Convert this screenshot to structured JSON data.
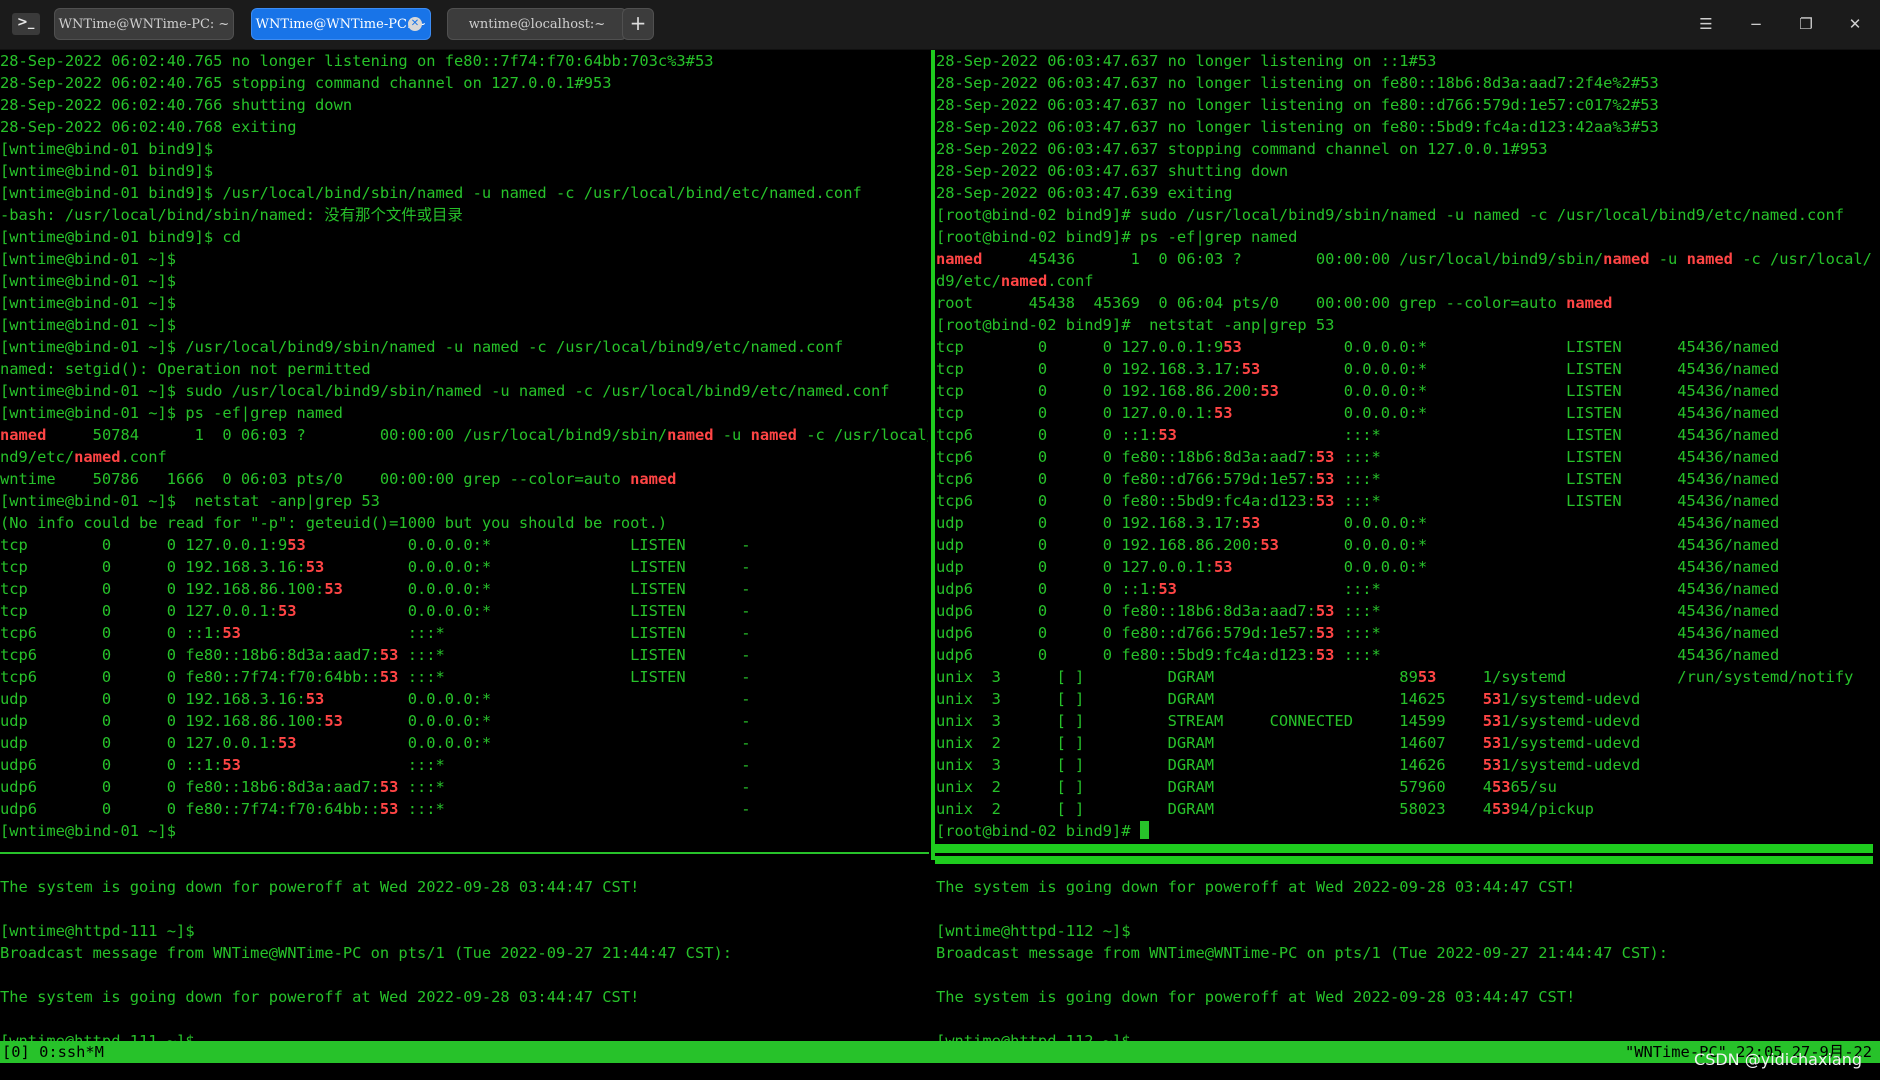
{
  "window": {
    "tabs": [
      {
        "label": "WNTime@WNTime-PC: ~",
        "active": false
      },
      {
        "label": "WNTime@WNTime-PC: ~",
        "active": true
      },
      {
        "label": "wntime@localhost:~",
        "active": false
      }
    ],
    "add_tab": "+",
    "controls": {
      "menu": "☰",
      "minimize": "−",
      "maximize": "❐",
      "close": "✕"
    }
  },
  "colors": {
    "terminal_green": "#27c22a",
    "highlight_red": "#ff4545",
    "active_tab": "#1874e8"
  },
  "panes": {
    "top_left": [
      [
        "28-Sep-2022 06:02:40.765 no longer listening on fe80::7f74:f70:64bb:703c%3#53"
      ],
      [
        "28-Sep-2022 06:02:40.765 stopping command channel on 127.0.0.1#953"
      ],
      [
        "28-Sep-2022 06:02:40.766 shutting down"
      ],
      [
        "28-Sep-2022 06:02:40.768 exiting"
      ],
      [
        "[wntime@bind-01 bind9]$"
      ],
      [
        "[wntime@bind-01 bind9]$"
      ],
      [
        "[wntime@bind-01 bind9]$ /usr/local/bind/sbin/named -u named -c /usr/local/bind/etc/named.conf"
      ],
      [
        "-bash: /usr/local/bind/sbin/named: 没有那个文件或目录"
      ],
      [
        "[wntime@bind-01 bind9]$ cd"
      ],
      [
        "[wntime@bind-01 ~]$"
      ],
      [
        "[wntime@bind-01 ~]$"
      ],
      [
        "[wntime@bind-01 ~]$"
      ],
      [
        "[wntime@bind-01 ~]$"
      ],
      [
        "[wntime@bind-01 ~]$ /usr/local/bind9/sbin/named -u named -c /usr/local/bind9/etc/named.conf"
      ],
      [
        "named: setgid(): Operation not permitted"
      ],
      [
        "[wntime@bind-01 ~]$ sudo /usr/local/bind9/sbin/named -u named -c /usr/local/bind9/etc/named.conf"
      ],
      [
        "[wntime@bind-01 ~]$ ps -ef|grep named"
      ],
      [
        {
          "h": "named"
        },
        "     50784      1  0 06:03 ?        00:00:00 /usr/local/bind9/sbin/",
        {
          "h": "named"
        },
        " -u ",
        {
          "h": "named"
        },
        " -c /usr/local/bi"
      ],
      [
        "nd9/etc/",
        {
          "h": "named"
        },
        ".conf"
      ],
      [
        "wntime    50786   1666  0 06:03 pts/0    00:00:00 grep --color=auto ",
        {
          "h": "named"
        }
      ],
      [
        "[wntime@bind-01 ~]$  netstat -anp|grep 53"
      ],
      [
        "(No info could be read for \"-p\": geteuid()=1000 but you should be root.)"
      ],
      [
        "tcp        0      0 127.0.0.1:9",
        {
          "h": "53"
        },
        "           0.0.0.0:*               LISTEN      -"
      ],
      [
        "tcp        0      0 192.168.3.16:",
        {
          "h": "53"
        },
        "         0.0.0.0:*               LISTEN      -"
      ],
      [
        "tcp        0      0 192.168.86.100:",
        {
          "h": "53"
        },
        "       0.0.0.0:*               LISTEN      -"
      ],
      [
        "tcp        0      0 127.0.0.1:",
        {
          "h": "53"
        },
        "            0.0.0.0:*               LISTEN      -"
      ],
      [
        "tcp6       0      0 ::1:",
        {
          "h": "53"
        },
        "                  :::*                    LISTEN      -"
      ],
      [
        "tcp6       0      0 fe80::18b6:8d3a:aad7:",
        {
          "h": "53"
        },
        " :::*                    LISTEN      -"
      ],
      [
        "tcp6       0      0 fe80::7f74:f70:64bb::",
        {
          "h": "53"
        },
        " :::*                    LISTEN      -"
      ],
      [
        "udp        0      0 192.168.3.16:",
        {
          "h": "53"
        },
        "         0.0.0.0:*                           -"
      ],
      [
        "udp        0      0 192.168.86.100:",
        {
          "h": "53"
        },
        "       0.0.0.0:*                           -"
      ],
      [
        "udp        0      0 127.0.0.1:",
        {
          "h": "53"
        },
        "            0.0.0.0:*                           -"
      ],
      [
        "udp6       0      0 ::1:",
        {
          "h": "53"
        },
        "                  :::*                                -"
      ],
      [
        "udp6       0      0 fe80::18b6:8d3a:aad7:",
        {
          "h": "53"
        },
        " :::*                                -"
      ],
      [
        "udp6       0      0 fe80::7f74:f70:64bb::",
        {
          "h": "53"
        },
        " :::*                                -"
      ],
      [
        "[wntime@bind-01 ~]$"
      ]
    ],
    "top_right": [
      [
        "28-Sep-2022 06:03:47.637 no longer listening on ::1#53"
      ],
      [
        "28-Sep-2022 06:03:47.637 no longer listening on fe80::18b6:8d3a:aad7:2f4e%2#53"
      ],
      [
        "28-Sep-2022 06:03:47.637 no longer listening on fe80::d766:579d:1e57:c017%2#53"
      ],
      [
        "28-Sep-2022 06:03:47.637 no longer listening on fe80::5bd9:fc4a:d123:42aa%3#53"
      ],
      [
        "28-Sep-2022 06:03:47.637 stopping command channel on 127.0.0.1#953"
      ],
      [
        "28-Sep-2022 06:03:47.637 shutting down"
      ],
      [
        "28-Sep-2022 06:03:47.639 exiting"
      ],
      [
        "[root@bind-02 bind9]# sudo /usr/local/bind9/sbin/named -u named -c /usr/local/bind9/etc/named.conf"
      ],
      [
        "[root@bind-02 bind9]# ps -ef|grep named"
      ],
      [
        {
          "h": "named"
        },
        "     45436      1  0 06:03 ?        00:00:00 /usr/local/bind9/sbin/",
        {
          "h": "named"
        },
        " -u ",
        {
          "h": "named"
        },
        " -c /usr/local/bin"
      ],
      [
        "d9/etc/",
        {
          "h": "named"
        },
        ".conf"
      ],
      [
        "root      45438  45369  0 06:04 pts/0    00:00:00 grep --color=auto ",
        {
          "h": "named"
        }
      ],
      [
        "[root@bind-02 bind9]#  netstat -anp|grep 53"
      ],
      [
        "tcp        0      0 127.0.0.1:9",
        {
          "h": "53"
        },
        "           0.0.0.0:*               LISTEN      45436/named"
      ],
      [
        "tcp        0      0 192.168.3.17:",
        {
          "h": "53"
        },
        "         0.0.0.0:*               LISTEN      45436/named"
      ],
      [
        "tcp        0      0 192.168.86.200:",
        {
          "h": "53"
        },
        "       0.0.0.0:*               LISTEN      45436/named"
      ],
      [
        "tcp        0      0 127.0.0.1:",
        {
          "h": "53"
        },
        "            0.0.0.0:*               LISTEN      45436/named"
      ],
      [
        "tcp6       0      0 ::1:",
        {
          "h": "53"
        },
        "                  :::*                    LISTEN      45436/named"
      ],
      [
        "tcp6       0      0 fe80::18b6:8d3a:aad7:",
        {
          "h": "53"
        },
        " :::*                    LISTEN      45436/named"
      ],
      [
        "tcp6       0      0 fe80::d766:579d:1e57:",
        {
          "h": "53"
        },
        " :::*                    LISTEN      45436/named"
      ],
      [
        "tcp6       0      0 fe80::5bd9:fc4a:d123:",
        {
          "h": "53"
        },
        " :::*                    LISTEN      45436/named"
      ],
      [
        "udp        0      0 192.168.3.17:",
        {
          "h": "53"
        },
        "         0.0.0.0:*                           45436/named"
      ],
      [
        "udp        0      0 192.168.86.200:",
        {
          "h": "53"
        },
        "       0.0.0.0:*                           45436/named"
      ],
      [
        "udp        0      0 127.0.0.1:",
        {
          "h": "53"
        },
        "            0.0.0.0:*                           45436/named"
      ],
      [
        "udp6       0      0 ::1:",
        {
          "h": "53"
        },
        "                  :::*                                45436/named"
      ],
      [
        "udp6       0      0 fe80::18b6:8d3a:aad7:",
        {
          "h": "53"
        },
        " :::*                                45436/named"
      ],
      [
        "udp6       0      0 fe80::d766:579d:1e57:",
        {
          "h": "53"
        },
        " :::*                                45436/named"
      ],
      [
        "udp6       0      0 fe80::5bd9:fc4a:d123:",
        {
          "h": "53"
        },
        " :::*                                45436/named"
      ],
      [
        "unix  3      [ ]         DGRAM                    89",
        {
          "h": "53"
        },
        "     1/systemd            /run/systemd/notify"
      ],
      [
        "unix  3      [ ]         DGRAM                    14625    ",
        {
          "h": "53"
        },
        "1/systemd-udevd"
      ],
      [
        "unix  3      [ ]         STREAM     CONNECTED     14599    ",
        {
          "h": "53"
        },
        "1/systemd-udevd"
      ],
      [
        "unix  2      [ ]         DGRAM                    14607    ",
        {
          "h": "53"
        },
        "1/systemd-udevd"
      ],
      [
        "unix  3      [ ]         DGRAM                    14626    ",
        {
          "h": "53"
        },
        "1/systemd-udevd"
      ],
      [
        "unix  2      [ ]         DGRAM                    57960    4",
        {
          "h": "53"
        },
        "65/su"
      ],
      [
        "unix  2      [ ]         DGRAM                    58023    4",
        {
          "h": "53"
        },
        "94/pickup"
      ],
      [
        "[root@bind-02 bind9]# "
      ]
    ],
    "bottom_left": [
      [
        ""
      ],
      [
        "The system is going down for poweroff at Wed 2022-09-28 03:44:47 CST!"
      ],
      [
        ""
      ],
      [
        "[wntime@httpd-111 ~]$"
      ],
      [
        "Broadcast message from WNTime@WNTime-PC on pts/1 (Tue 2022-09-27 21:44:47 CST):"
      ],
      [
        ""
      ],
      [
        "The system is going down for poweroff at Wed 2022-09-28 03:44:47 CST!"
      ],
      [
        ""
      ],
      [
        "[wntime@httpd-111 ~]$"
      ]
    ],
    "bottom_right": [
      [
        ""
      ],
      [
        "The system is going down for poweroff at Wed 2022-09-28 03:44:47 CST!"
      ],
      [
        ""
      ],
      [
        "[wntime@httpd-112 ~]$"
      ],
      [
        "Broadcast message from WNTime@WNTime-PC on pts/1 (Tue 2022-09-27 21:44:47 CST):"
      ],
      [
        ""
      ],
      [
        "The system is going down for poweroff at Wed 2022-09-28 03:44:47 CST!"
      ],
      [
        ""
      ],
      [
        "[wntime@httpd-112 ~]$"
      ]
    ]
  },
  "statusbar": {
    "left": "[0] 0:ssh*M",
    "right": "\"WNTime-PC\" 22:05 27-9月-22"
  },
  "watermark": "CSDN @yidichaxiang"
}
